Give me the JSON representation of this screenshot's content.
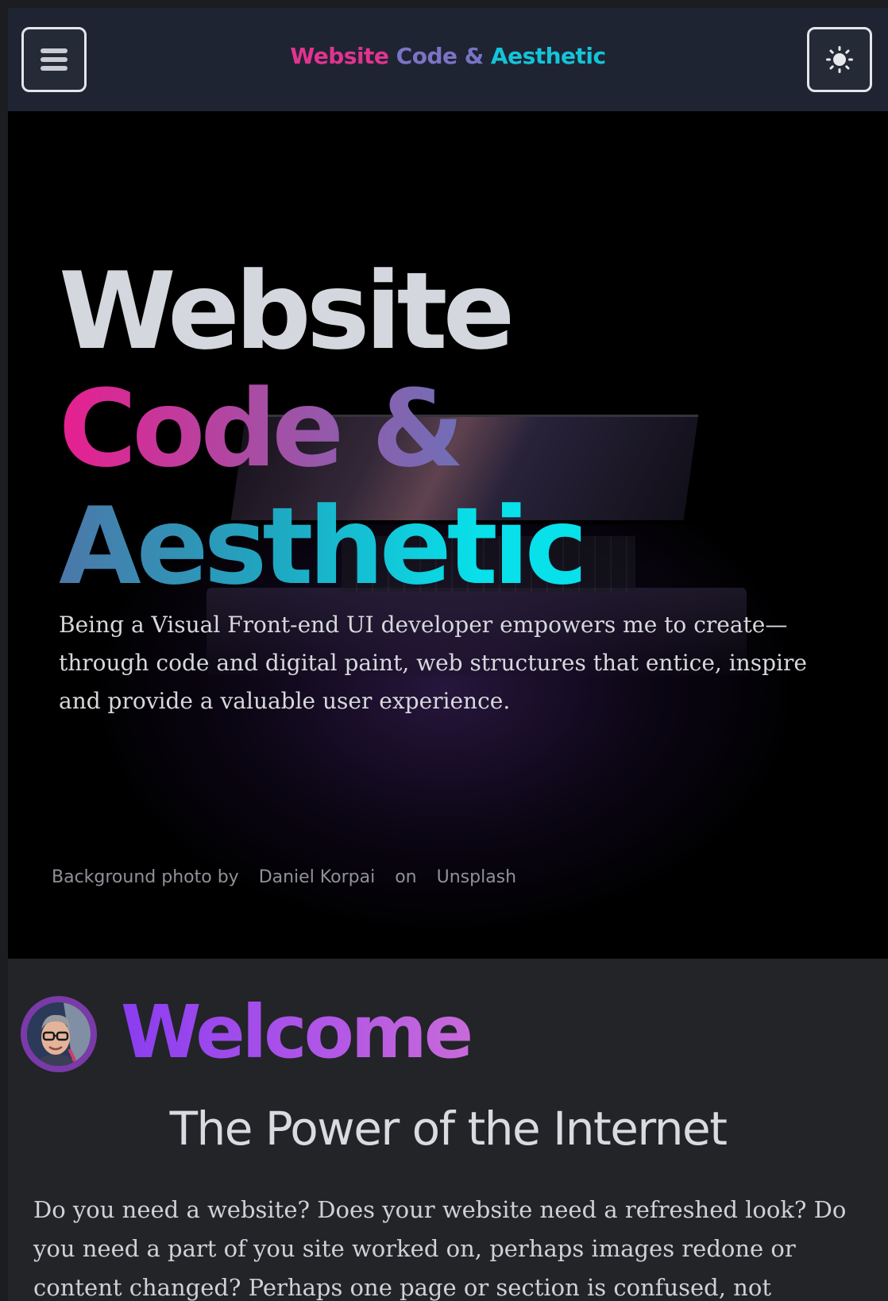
{
  "header": {
    "menu_icon": "hamburger-menu-icon",
    "theme_icon": "sun-icon",
    "title_part1": "Website",
    "title_part2": "Code &",
    "title_part3": "Aesthetic"
  },
  "hero": {
    "title_line1": "Website",
    "title_line2": "Code &",
    "title_line3": "Aesthetic",
    "description": "Being a Visual Front-end UI developer empowers me to create—through code and digital paint, web structures that entice, inspire and provide a valuable user experience.",
    "credit": {
      "prefix": "Background photo by",
      "author": "Daniel Korpai",
      "middle": "on",
      "source": "Unsplash"
    }
  },
  "welcome": {
    "heading": "Welcome",
    "avatar": "profile-avatar"
  },
  "section": {
    "title": "The Power of the Internet",
    "body": "Do you need a website? Does your website need a refreshed look? Do you need a part of you site worked on, perhaps images redone or content changed? Perhaps one page or section is confused, not cohesive?"
  },
  "colors": {
    "header_bg": "#1f2433",
    "hero_bg": "#000000",
    "page_bg": "#222428",
    "pink": "#e71f8f",
    "cyan": "#08e0ea",
    "purple": "#8a3df0"
  }
}
